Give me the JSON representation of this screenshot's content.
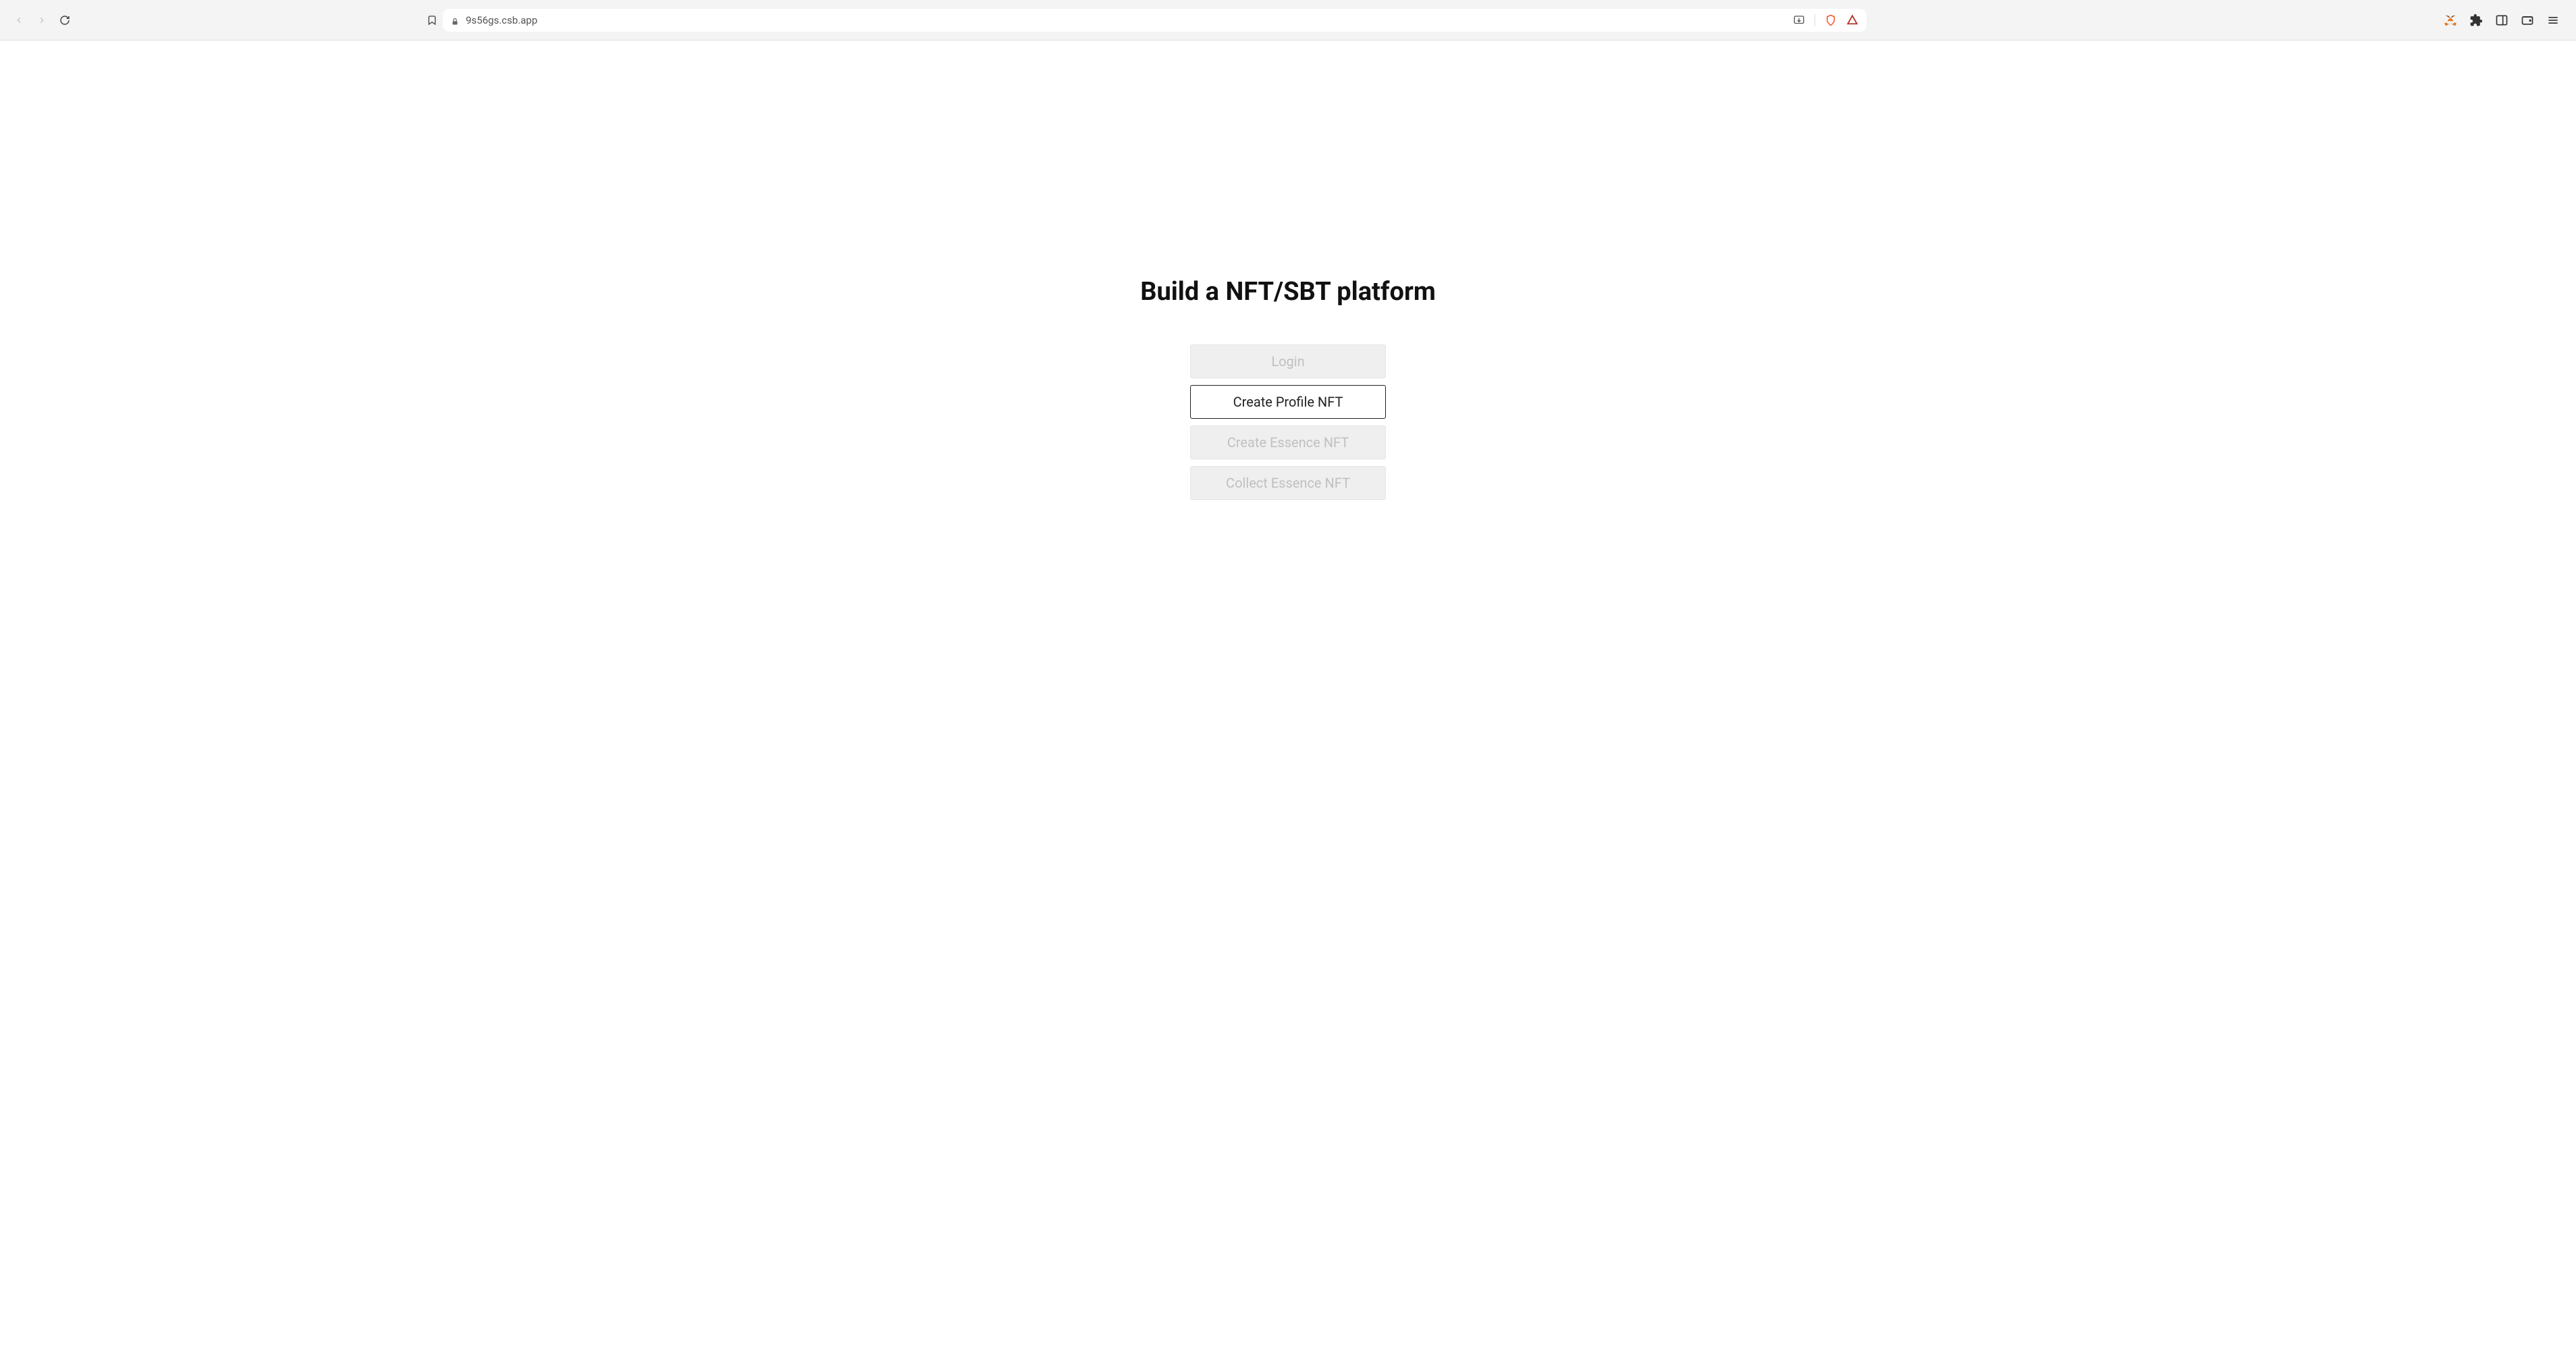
{
  "browser": {
    "url": "9s56gs.csb.app"
  },
  "page": {
    "title": "Build a NFT/SBT platform",
    "buttons": [
      {
        "label": "Login",
        "enabled": false
      },
      {
        "label": "Create Profile NFT",
        "enabled": true
      },
      {
        "label": "Create Essence NFT",
        "enabled": false
      },
      {
        "label": "Collect Essence NFT",
        "enabled": false
      }
    ]
  }
}
